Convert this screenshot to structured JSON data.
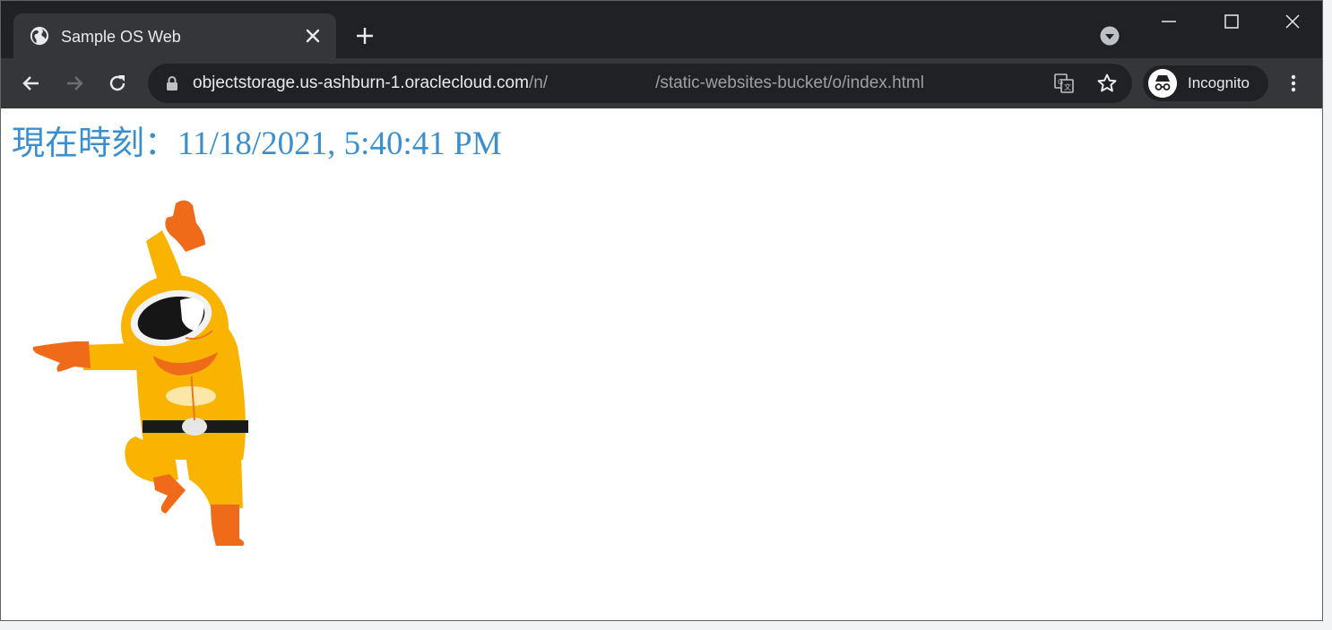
{
  "browser": {
    "tab": {
      "title": "Sample OS Web"
    },
    "address_bar": {
      "host": "objectstorage.us-ashburn-1.oraclecloud.com",
      "path_start": "/n/",
      "path_end": "/static-websites-bucket/o/index.html"
    },
    "profile": {
      "label": "Incognito"
    }
  },
  "page": {
    "time_label": "現在時刻：",
    "time_value": "11/18/2021, 5:40:41 PM"
  },
  "icons": {
    "favicon": "globe-icon",
    "tab_close": "close-icon",
    "new_tab": "plus-icon",
    "tab_search": "chevron-down-circle-icon",
    "minimize": "minimize-icon",
    "maximize": "maximize-icon",
    "window_close": "close-icon",
    "back": "arrow-left-icon",
    "forward": "arrow-right-icon",
    "reload": "reload-icon",
    "lock": "lock-icon",
    "translate": "translate-icon",
    "bookmark": "star-icon",
    "incognito": "incognito-icon",
    "menu": "kebab-menu-icon"
  },
  "colors": {
    "frame_dark": "#202124",
    "toolbar": "#35363a",
    "time_text": "#3a8fd0",
    "suit_yellow": "#f8b400",
    "suit_orange": "#ef6b1a"
  }
}
